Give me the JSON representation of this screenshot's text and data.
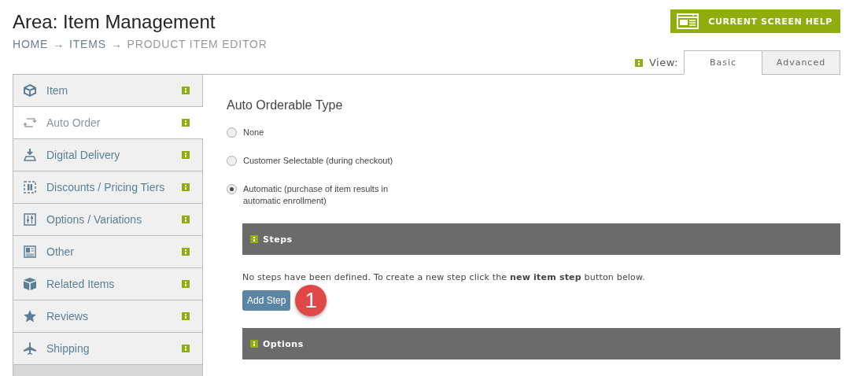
{
  "header": {
    "title": "Area: Item Management",
    "breadcrumb": [
      {
        "label": "HOME",
        "link": true
      },
      {
        "label": "ITEMS",
        "link": true
      },
      {
        "label": "PRODUCT ITEM EDITOR",
        "link": false
      }
    ],
    "separator": "→"
  },
  "help_button": {
    "label": "CURRENT SCREEN HELP"
  },
  "view": {
    "label": "View:",
    "tabs": [
      {
        "label": "Basic",
        "selected": true
      },
      {
        "label": "Advanced",
        "selected": false
      }
    ]
  },
  "sidebar": {
    "items": [
      {
        "label": "Item",
        "selected": false
      },
      {
        "label": "Auto Order",
        "selected": true
      },
      {
        "label": "Digital Delivery",
        "selected": false
      },
      {
        "label": "Discounts / Pricing Tiers",
        "selected": false
      },
      {
        "label": "Options / Variations",
        "selected": false
      },
      {
        "label": "Other",
        "selected": false
      },
      {
        "label": "Related Items",
        "selected": false
      },
      {
        "label": "Reviews",
        "selected": false
      },
      {
        "label": "Shipping",
        "selected": false
      }
    ]
  },
  "auto_orderable": {
    "heading": "Auto Orderable Type",
    "options": [
      {
        "label": "None",
        "selected": false
      },
      {
        "label": "Customer Selectable (during checkout)",
        "selected": false
      },
      {
        "label": "Automatic (purchase of item results in automatic enrollment)",
        "selected": true
      }
    ]
  },
  "sections": [
    {
      "title": "Steps",
      "message": "No steps have been defined. To create a new step click the **new item step** button below.",
      "button": "Add Step",
      "callout": "1"
    },
    {
      "title": "Options"
    }
  ]
}
